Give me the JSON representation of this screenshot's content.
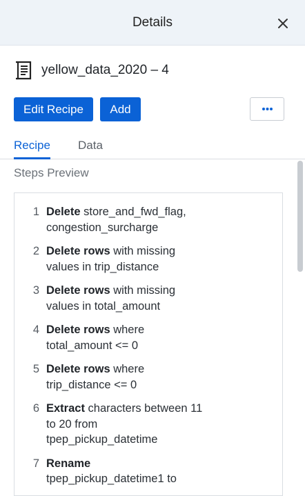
{
  "header": {
    "title": "Details"
  },
  "dataset": {
    "name": "yellow_data_2020 – 4",
    "icon": "recipe-document-icon"
  },
  "buttons": {
    "edit_label": "Edit Recipe",
    "add_label": "Add",
    "more_icon": "more-horizontal-icon"
  },
  "tabs": [
    {
      "label": "Recipe",
      "active": true
    },
    {
      "label": "Data",
      "active": false
    }
  ],
  "section_title": "Steps Preview",
  "steps": [
    {
      "num": "1",
      "action": "Delete",
      "detail": "store_and_fwd_flag, congestion_surcharge"
    },
    {
      "num": "2",
      "action": "Delete rows",
      "detail": "with missing values in trip_distance"
    },
    {
      "num": "3",
      "action": "Delete rows",
      "detail": "with missing values in total_amount"
    },
    {
      "num": "4",
      "action": "Delete rows",
      "detail": "where total_amount <= 0"
    },
    {
      "num": "5",
      "action": "Delete rows",
      "detail": "where trip_distance <= 0"
    },
    {
      "num": "6",
      "action": "Extract",
      "detail": "characters between 11 to 20 from tpep_pickup_datetime"
    },
    {
      "num": "7",
      "action": "Rename",
      "detail": "tpep_pickup_datetime1 to"
    }
  ],
  "colors": {
    "accent": "#0b62d6",
    "header_bg": "#eef3f8"
  }
}
